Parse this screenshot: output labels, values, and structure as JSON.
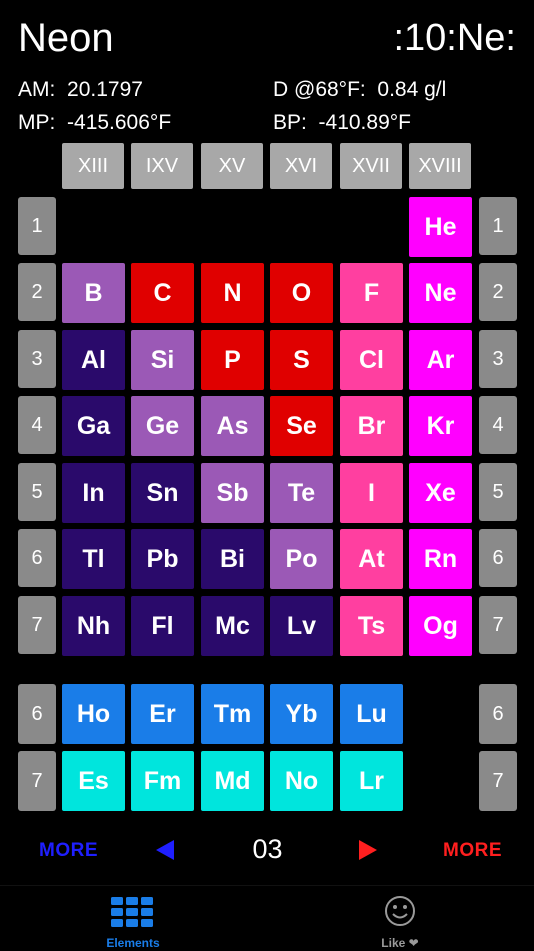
{
  "header": {
    "title": "Neon",
    "symbol_code": ":10:Ne:"
  },
  "info": {
    "am_label": "AM:",
    "am_value": "20.1797",
    "density_label": "D @68°F:",
    "density_value": "0.84 g/l",
    "mp_label": "MP:",
    "mp_value": "-415.606°F",
    "bp_label": "BP:",
    "bp_value": "-410.89°F"
  },
  "groups": [
    "XIII",
    "IXV",
    "XV",
    "XVI",
    "XVII",
    "XVIII"
  ],
  "periods_main": [
    "1",
    "2",
    "3",
    "4",
    "5",
    "6",
    "7"
  ],
  "periods_f": [
    "6",
    "7"
  ],
  "colors": {
    "boron_group": "#9b59b6",
    "nonmetal_red": "#e00000",
    "halogen_pink": "#ff3fa0",
    "noble_magenta": "#ff00ff",
    "post_transition": "#2a0a6b",
    "lanthanide_blue": "#1a7de8",
    "actinide_cyan": "#00e5dd",
    "period_grey": "#8a8a8a",
    "group_grey": "#a8a8a8",
    "more_left": "#1f1fff",
    "more_right": "#ff1f1f",
    "tab_active": "#1a7de8",
    "tab_inactive": "#9a9a9a"
  },
  "elements": [
    {
      "sym": "He",
      "row": 0,
      "col": 5,
      "color": "noble_magenta"
    },
    {
      "sym": "B",
      "row": 1,
      "col": 0,
      "color": "boron_group"
    },
    {
      "sym": "C",
      "row": 1,
      "col": 1,
      "color": "nonmetal_red"
    },
    {
      "sym": "N",
      "row": 1,
      "col": 2,
      "color": "nonmetal_red"
    },
    {
      "sym": "O",
      "row": 1,
      "col": 3,
      "color": "nonmetal_red"
    },
    {
      "sym": "F",
      "row": 1,
      "col": 4,
      "color": "halogen_pink"
    },
    {
      "sym": "Ne",
      "row": 1,
      "col": 5,
      "color": "noble_magenta"
    },
    {
      "sym": "Al",
      "row": 2,
      "col": 0,
      "color": "post_transition"
    },
    {
      "sym": "Si",
      "row": 2,
      "col": 1,
      "color": "boron_group"
    },
    {
      "sym": "P",
      "row": 2,
      "col": 2,
      "color": "nonmetal_red"
    },
    {
      "sym": "S",
      "row": 2,
      "col": 3,
      "color": "nonmetal_red"
    },
    {
      "sym": "Cl",
      "row": 2,
      "col": 4,
      "color": "halogen_pink"
    },
    {
      "sym": "Ar",
      "row": 2,
      "col": 5,
      "color": "noble_magenta"
    },
    {
      "sym": "Ga",
      "row": 3,
      "col": 0,
      "color": "post_transition"
    },
    {
      "sym": "Ge",
      "row": 3,
      "col": 1,
      "color": "boron_group"
    },
    {
      "sym": "As",
      "row": 3,
      "col": 2,
      "color": "boron_group"
    },
    {
      "sym": "Se",
      "row": 3,
      "col": 3,
      "color": "nonmetal_red"
    },
    {
      "sym": "Br",
      "row": 3,
      "col": 4,
      "color": "halogen_pink"
    },
    {
      "sym": "Kr",
      "row": 3,
      "col": 5,
      "color": "noble_magenta"
    },
    {
      "sym": "In",
      "row": 4,
      "col": 0,
      "color": "post_transition"
    },
    {
      "sym": "Sn",
      "row": 4,
      "col": 1,
      "color": "post_transition"
    },
    {
      "sym": "Sb",
      "row": 4,
      "col": 2,
      "color": "boron_group"
    },
    {
      "sym": "Te",
      "row": 4,
      "col": 3,
      "color": "boron_group"
    },
    {
      "sym": "I",
      "row": 4,
      "col": 4,
      "color": "halogen_pink"
    },
    {
      "sym": "Xe",
      "row": 4,
      "col": 5,
      "color": "noble_magenta"
    },
    {
      "sym": "Tl",
      "row": 5,
      "col": 0,
      "color": "post_transition"
    },
    {
      "sym": "Pb",
      "row": 5,
      "col": 1,
      "color": "post_transition"
    },
    {
      "sym": "Bi",
      "row": 5,
      "col": 2,
      "color": "post_transition"
    },
    {
      "sym": "Po",
      "row": 5,
      "col": 3,
      "color": "boron_group"
    },
    {
      "sym": "At",
      "row": 5,
      "col": 4,
      "color": "halogen_pink"
    },
    {
      "sym": "Rn",
      "row": 5,
      "col": 5,
      "color": "noble_magenta"
    },
    {
      "sym": "Nh",
      "row": 6,
      "col": 0,
      "color": "post_transition"
    },
    {
      "sym": "Fl",
      "row": 6,
      "col": 1,
      "color": "post_transition"
    },
    {
      "sym": "Mc",
      "row": 6,
      "col": 2,
      "color": "post_transition"
    },
    {
      "sym": "Lv",
      "row": 6,
      "col": 3,
      "color": "post_transition"
    },
    {
      "sym": "Ts",
      "row": 6,
      "col": 4,
      "color": "halogen_pink"
    },
    {
      "sym": "Og",
      "row": 6,
      "col": 5,
      "color": "noble_magenta"
    }
  ],
  "f_elements": [
    {
      "sym": "Ho",
      "row": 0,
      "col": 0,
      "color": "lanthanide_blue"
    },
    {
      "sym": "Er",
      "row": 0,
      "col": 1,
      "color": "lanthanide_blue"
    },
    {
      "sym": "Tm",
      "row": 0,
      "col": 2,
      "color": "lanthanide_blue"
    },
    {
      "sym": "Yb",
      "row": 0,
      "col": 3,
      "color": "lanthanide_blue"
    },
    {
      "sym": "Lu",
      "row": 0,
      "col": 4,
      "color": "lanthanide_blue"
    },
    {
      "sym": "Es",
      "row": 1,
      "col": 0,
      "color": "actinide_cyan"
    },
    {
      "sym": "Fm",
      "row": 1,
      "col": 1,
      "color": "actinide_cyan"
    },
    {
      "sym": "Md",
      "row": 1,
      "col": 2,
      "color": "actinide_cyan"
    },
    {
      "sym": "No",
      "row": 1,
      "col": 3,
      "color": "actinide_cyan"
    },
    {
      "sym": "Lr",
      "row": 1,
      "col": 4,
      "color": "actinide_cyan"
    }
  ],
  "nav": {
    "more_left": "MORE",
    "prev_icon": "triangle-left-icon",
    "page": "03",
    "next_icon": "triangle-right-icon",
    "more_right": "MORE"
  },
  "tabs": [
    {
      "label": "Elements",
      "icon": "grid-icon",
      "active": true
    },
    {
      "label": "Like ❤",
      "icon": "smiley-icon",
      "active": false
    }
  ]
}
